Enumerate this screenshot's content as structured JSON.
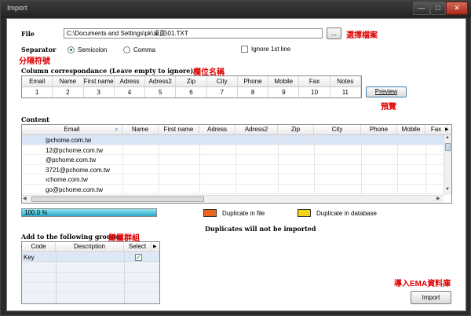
{
  "window": {
    "title": "Import",
    "buttons": {
      "minimize": "—",
      "maximize": "□",
      "close": "✕"
    }
  },
  "file": {
    "label": "File",
    "path": "C:\\Documents and Settings\\pk\\桌面\\01.TXT",
    "browse_label": "...",
    "annotation": "選擇檔案"
  },
  "separator": {
    "label": "Separator",
    "annotation": "分隔符號",
    "options": [
      "Semicolon",
      "Comma"
    ],
    "selected": "Semicolon",
    "ignore_label": "Ignore 1st line"
  },
  "correspondence": {
    "label": "Column correspondance (Leave empty to ignore)",
    "annotation": "欄位名稱",
    "headers": [
      "Email",
      "Name",
      "First name",
      "Adress",
      "Adress2",
      "Zip",
      "City",
      "Phone",
      "Mobile",
      "Fax",
      "Notes"
    ],
    "values": [
      "1",
      "2",
      "3",
      "4",
      "5",
      "6",
      "7",
      "8",
      "9",
      "10",
      "11"
    ],
    "preview_label": "Preview",
    "preview_annotation": "預覽"
  },
  "content": {
    "label": "Content",
    "headers": [
      "Email",
      "Name",
      "First name",
      "Adress",
      "Adress2",
      "Zip",
      "City",
      "Phone",
      "Mobile",
      "Fax"
    ],
    "rows": [
      "|pchome.com.tw",
      "12@pchome.com.tw",
      "@pchome.com.tw",
      "3721@pchome.com.tw",
      "ıchome.com.tw",
      "go@pchome.com.tw"
    ]
  },
  "progress": {
    "label": "100.0 %",
    "fraction": 1.0
  },
  "legend": {
    "dup_file": "Duplicate in file",
    "dup_db": "Duplicate in database",
    "dup_file_color": "#e8661a",
    "dup_db_color": "#f2d21a",
    "note": "Duplicates will not be imported"
  },
  "groups": {
    "label": "Add to the following groups",
    "annotation": "歸屬群組",
    "headers": [
      "Code",
      "Description",
      "Select"
    ],
    "row": {
      "code": "Key",
      "description": "",
      "select": true
    }
  },
  "import": {
    "annotation": "導入EMA資料庫",
    "label": "Import"
  }
}
